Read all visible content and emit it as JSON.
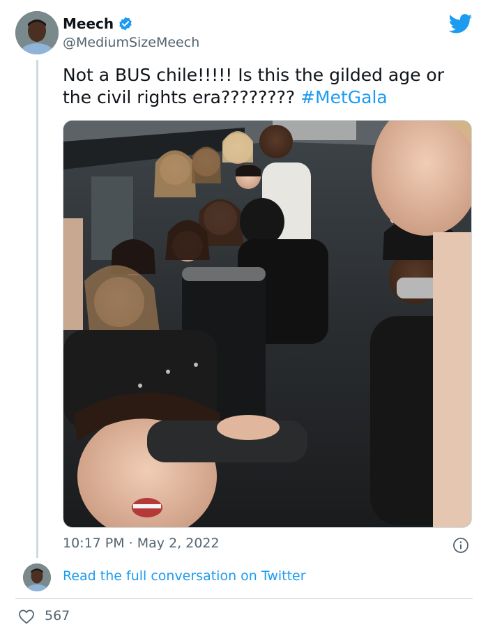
{
  "author": {
    "name": "Meech",
    "handle": "@MediumSizeMeech",
    "verified": true
  },
  "tweet": {
    "text_main": "Not a BUS chile!!!!! Is this the gilded age or the civil rights era???????? ",
    "hashtag": "#MetGala",
    "timestamp": "10:17 PM · May 2, 2022"
  },
  "footer": {
    "read_conversation": "Read the full conversation on Twitter",
    "like_count": "567"
  },
  "icons": {
    "brand": "twitter-bird-icon",
    "verified": "verified-badge-icon",
    "info": "info-icon",
    "like": "heart-icon"
  },
  "colors": {
    "accent": "#1d9bf0",
    "text": "#0f1419",
    "secondary": "#536471",
    "border": "#cfd9de"
  }
}
